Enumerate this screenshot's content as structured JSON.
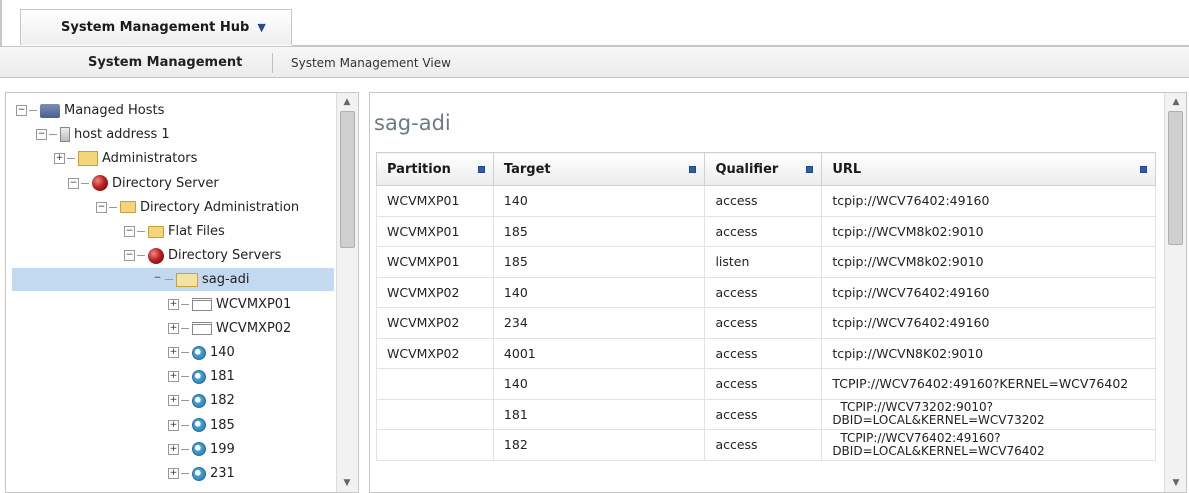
{
  "header": {
    "hub_label": "System Management Hub",
    "hub_caret": "▼"
  },
  "subnav": {
    "active": "System Management",
    "view": "System Management View"
  },
  "tree": {
    "nodes": [
      {
        "label": "Managed Hosts",
        "expander": "−",
        "icon": "hosts-icon"
      },
      {
        "label": "host address 1",
        "expander": "−",
        "icon": "server-icon"
      },
      {
        "label": "Administrators",
        "expander": "+",
        "icon": "admin-folder-icon"
      },
      {
        "label": "Directory Server",
        "expander": "−",
        "icon": "red-ball-icon"
      },
      {
        "label": "Directory Administration",
        "expander": "−",
        "icon": "folder-icon"
      },
      {
        "label": "Flat Files",
        "expander": "−",
        "icon": "folder-icon"
      },
      {
        "label": "Directory Servers",
        "expander": "−",
        "icon": "red-ball-icon"
      },
      {
        "label": "sag-adi",
        "expander": "−",
        "icon": "sag-folder-icon"
      },
      {
        "label": "WCVMXP01",
        "expander": "+",
        "icon": "partition-icon"
      },
      {
        "label": "WCVMXP02",
        "expander": "+",
        "icon": "partition-icon"
      },
      {
        "label": "140",
        "expander": "+",
        "icon": "blue-target-icon"
      },
      {
        "label": "181",
        "expander": "+",
        "icon": "blue-target-icon"
      },
      {
        "label": "182",
        "expander": "+",
        "icon": "blue-target-icon"
      },
      {
        "label": "185",
        "expander": "+",
        "icon": "blue-target-icon"
      },
      {
        "label": "199",
        "expander": "+",
        "icon": "blue-target-icon"
      },
      {
        "label": "231",
        "expander": "+",
        "icon": "blue-target-icon"
      }
    ]
  },
  "content": {
    "title": "sag-adi",
    "columns": [
      "Partition",
      "Target",
      "Qualifier",
      "URL"
    ],
    "rows": [
      {
        "partition": "WCVMXP01",
        "target": "140",
        "qualifier": "access",
        "url": "tcpip://WCV76402:49160"
      },
      {
        "partition": "WCVMXP01",
        "target": "185",
        "qualifier": "access",
        "url": "tcpip://WCVM8k02:9010"
      },
      {
        "partition": "WCVMXP01",
        "target": "185",
        "qualifier": "listen",
        "url": "tcpip://WCVM8k02:9010"
      },
      {
        "partition": "WCVMXP02",
        "target": "140",
        "qualifier": "access",
        "url": "tcpip://WCV76402:49160"
      },
      {
        "partition": "WCVMXP02",
        "target": "234",
        "qualifier": "access",
        "url": "tcpip://WCV76402:49160"
      },
      {
        "partition": "WCVMXP02",
        "target": "4001",
        "qualifier": "access",
        "url": "tcpip://WCVN8K02:9010"
      },
      {
        "partition": "",
        "target": "140",
        "qualifier": "access",
        "url": "TCPIP://WCV76402:49160?KERNEL=WCV76402"
      },
      {
        "partition": "",
        "target": "181",
        "qualifier": "access",
        "url": "TCPIP://WCV73202:9010?",
        "url2": "DBID=LOCAL&KERNEL=WCV73202"
      },
      {
        "partition": "",
        "target": "182",
        "qualifier": "access",
        "url": "TCPIP://WCV76402:49160?",
        "url2": "DBID=LOCAL&KERNEL=WCV76402"
      }
    ]
  }
}
